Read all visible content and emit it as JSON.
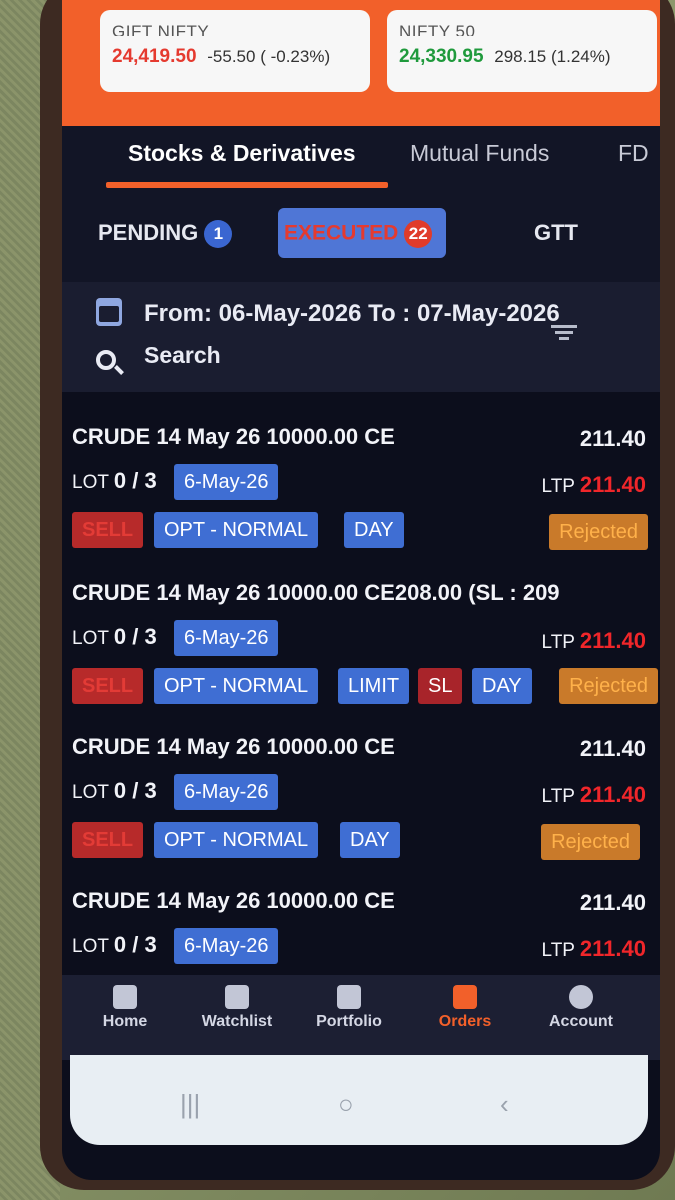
{
  "market": {
    "gift": {
      "name": "GIFT NIFTY",
      "value": "24,419.50",
      "change": "-55.50 ( -0.23%)"
    },
    "nifty": {
      "name": "NIFTY 50",
      "value": "24,330.95",
      "change": "298.15 (1.24%)"
    }
  },
  "tabs": [
    {
      "label": "Stocks & Derivatives"
    },
    {
      "label": "Mutual Funds"
    },
    {
      "label": "FD"
    }
  ],
  "subtabs": {
    "pending": {
      "label": "PENDING",
      "count": "1"
    },
    "executed": {
      "label": "EXECUTED",
      "count": "22"
    },
    "gtt": {
      "label": "GTT"
    }
  },
  "filter": {
    "date_range": "From: 06-May-2026 To : 07-May-2026",
    "search_label": "Search"
  },
  "orders": [
    {
      "title": "CRUDE 14 May 26 10000.00 CE",
      "price": "211.40",
      "lot_label": "LOT",
      "lot": "0 / 3",
      "date": "6-May-26",
      "side": "SELL",
      "product": "OPT - NORMAL",
      "validity": "DAY",
      "ltp_label": "LTP",
      "ltp": "211.40",
      "status": "Rejected"
    },
    {
      "title": "CRUDE 14 May 26 10000.00 CE208.00 (SL : 209",
      "lot_label": "LOT",
      "lot": "0 / 3",
      "date": "6-May-26",
      "side": "SELL",
      "product": "OPT - NORMAL",
      "order_type": "LIMIT",
      "sl": "SL",
      "validity": "DAY",
      "ltp_label": "LTP",
      "ltp": "211.40",
      "status": "Rejected"
    },
    {
      "title": "CRUDE 14 May 26 10000.00 CE",
      "price": "211.40",
      "lot_label": "LOT",
      "lot": "0 / 3",
      "date": "6-May-26",
      "side": "SELL",
      "product": "OPT - NORMAL",
      "validity": "DAY",
      "ltp_label": "LTP",
      "ltp": "211.40",
      "status": "Rejected"
    },
    {
      "title": "CRUDE 14 May 26 10000.00 CE",
      "price": "211.40",
      "lot_label": "LOT",
      "lot": "0 / 3",
      "date": "6-May-26",
      "ltp_label": "LTP",
      "ltp": "211.40"
    }
  ],
  "nav": [
    {
      "label": "Home",
      "icon": "home-icon"
    },
    {
      "label": "Watchlist",
      "icon": "watchlist-icon"
    },
    {
      "label": "Portfolio",
      "icon": "briefcase-icon"
    },
    {
      "label": "Orders",
      "icon": "orders-icon"
    },
    {
      "label": "Account",
      "icon": "account-icon"
    }
  ],
  "colors": {
    "brand_orange": "#f2602a",
    "negative_red": "#e53a2f",
    "positive_green": "#1f9a3c",
    "chip_blue": "#3f6ed3",
    "background_dark": "#0c0e1c"
  }
}
